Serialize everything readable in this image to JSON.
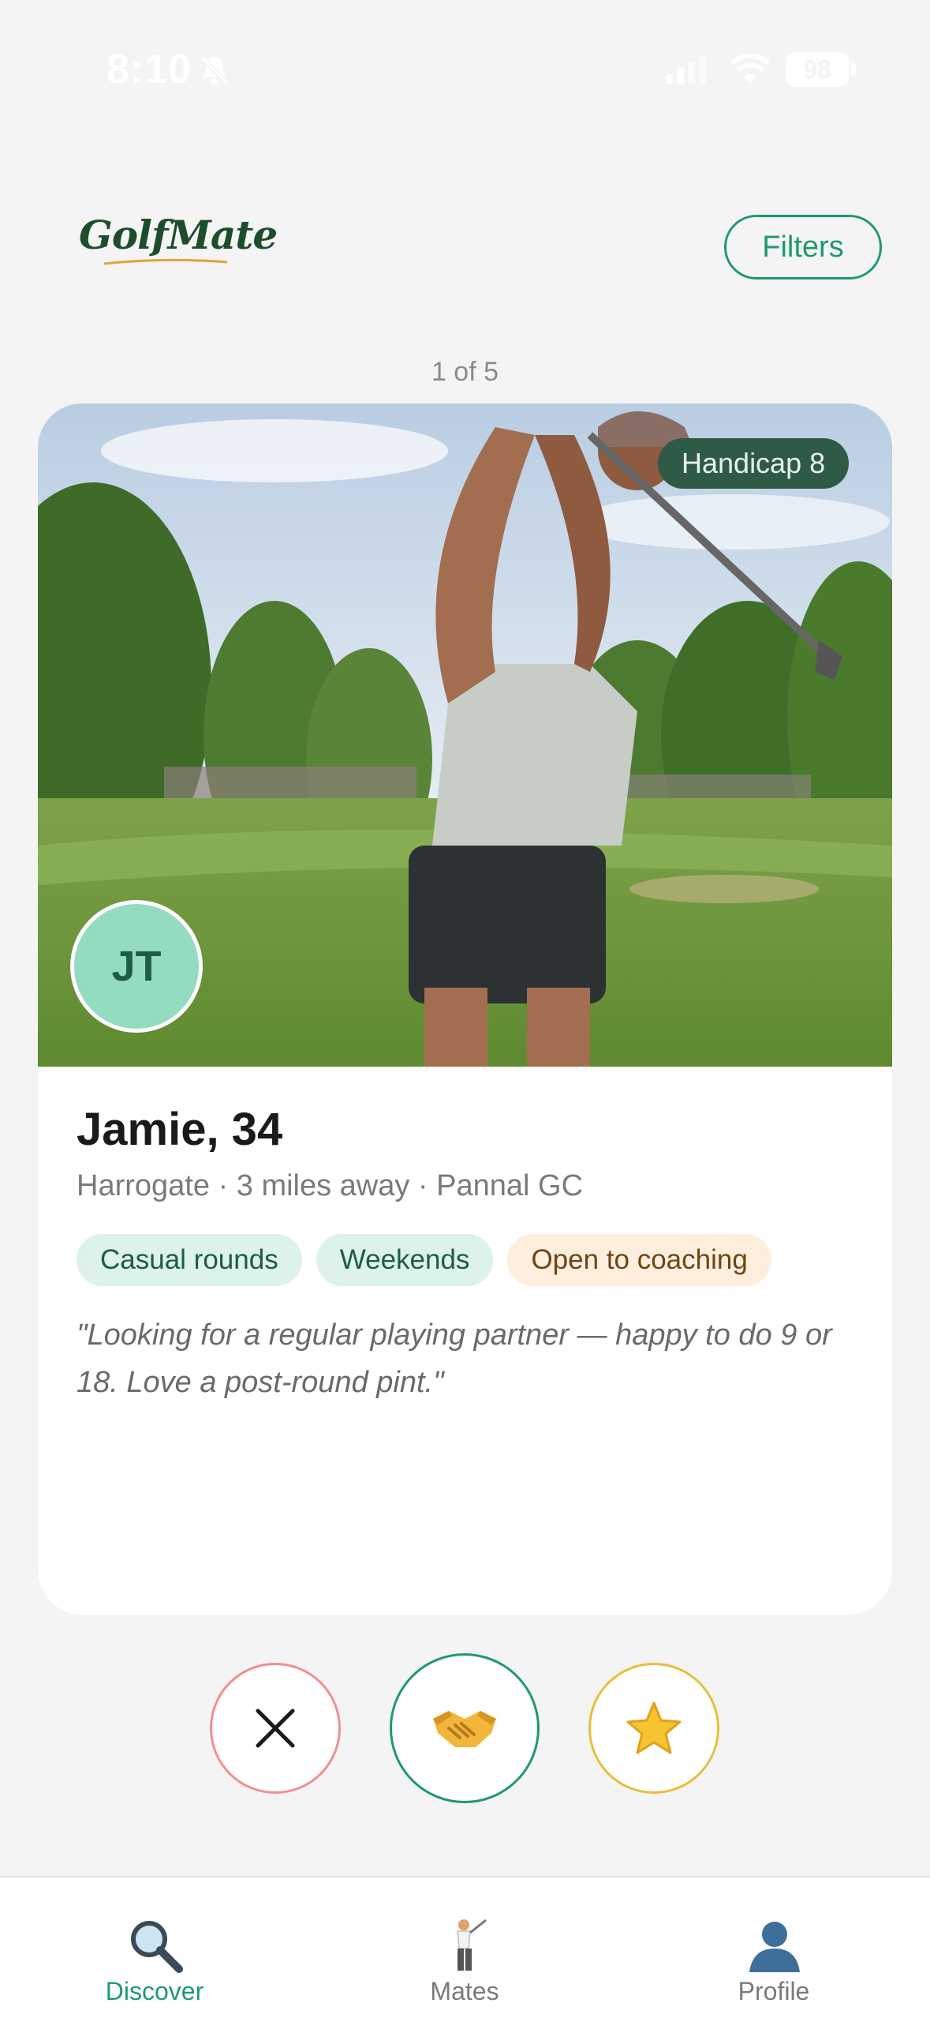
{
  "status_bar": {
    "time": "8:10",
    "battery": "98"
  },
  "header": {
    "logo": "GolfMate",
    "filters_label": "Filters"
  },
  "counter": "1 of 5",
  "profile": {
    "handicap_badge": "Handicap 8",
    "initials": "JT",
    "name_age": "Jamie, 34",
    "location_line": "Harrogate · 3 miles away · Pannal GC",
    "tags": [
      "Casual rounds",
      "Weekends",
      "Open to coaching"
    ],
    "bio": "\"Looking for a regular playing partner — happy to do 9 or 18. Love a post-round pint.\""
  },
  "actions": {
    "pass_icon": "close-icon",
    "mate_icon": "handshake-icon",
    "star_icon": "star-icon"
  },
  "nav": {
    "items": [
      {
        "label": "Discover",
        "icon": "magnifier-icon",
        "active": true
      },
      {
        "label": "Mates",
        "icon": "golfer-icon",
        "active": false
      },
      {
        "label": "Profile",
        "icon": "person-icon",
        "active": false
      }
    ]
  },
  "colors": {
    "accent": "#1f9a6b",
    "badge": "#2e5a46",
    "pass": "#f08f8f",
    "star": "#eabe3a"
  }
}
